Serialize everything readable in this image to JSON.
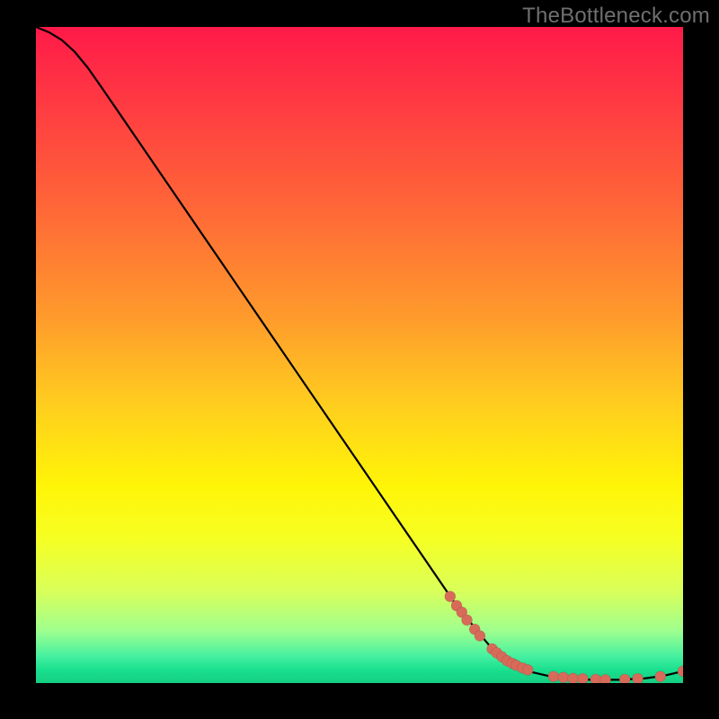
{
  "attribution": "TheBottleneck.com",
  "colors": {
    "dot": "#d86a5a",
    "curve": "#000000",
    "gradient_top": "#ff1a49",
    "gradient_mid": "#fff507",
    "gradient_bottom": "#15cf82"
  },
  "chart_data": {
    "type": "line",
    "title": "",
    "xlabel": "",
    "ylabel": "",
    "xlim": [
      0,
      100
    ],
    "ylim": [
      0,
      100
    ],
    "grid": false,
    "legend": null,
    "line": {
      "x": [
        0,
        2,
        4,
        6,
        8,
        10,
        15,
        20,
        25,
        30,
        35,
        40,
        45,
        50,
        55,
        60,
        65,
        70,
        73,
        76,
        80,
        83,
        86,
        90,
        94,
        97,
        100
      ],
      "y": [
        100,
        99.2,
        98.0,
        96.2,
        93.8,
        91.0,
        83.8,
        76.6,
        69.4,
        62.2,
        55.0,
        47.8,
        40.6,
        33.4,
        26.2,
        19.0,
        11.8,
        5.8,
        3.3,
        1.8,
        0.9,
        0.6,
        0.5,
        0.5,
        0.7,
        1.1,
        1.8
      ]
    },
    "dots": {
      "x": [
        64.0,
        65.0,
        65.8,
        66.6,
        67.8,
        68.6,
        70.5,
        71.2,
        72.0,
        72.8,
        73.6,
        74.2,
        75.2,
        76.0,
        80.0,
        81.5,
        83.0,
        84.5,
        86.5,
        88.0,
        91.0,
        93.0,
        96.5,
        100.0
      ],
      "y": [
        13.2,
        11.8,
        10.8,
        9.6,
        8.2,
        7.2,
        5.2,
        4.6,
        4.0,
        3.4,
        3.0,
        2.7,
        2.3,
        2.0,
        1.0,
        0.85,
        0.7,
        0.65,
        0.55,
        0.5,
        0.55,
        0.65,
        1.0,
        1.8
      ]
    },
    "dot_radius_px": 6
  }
}
